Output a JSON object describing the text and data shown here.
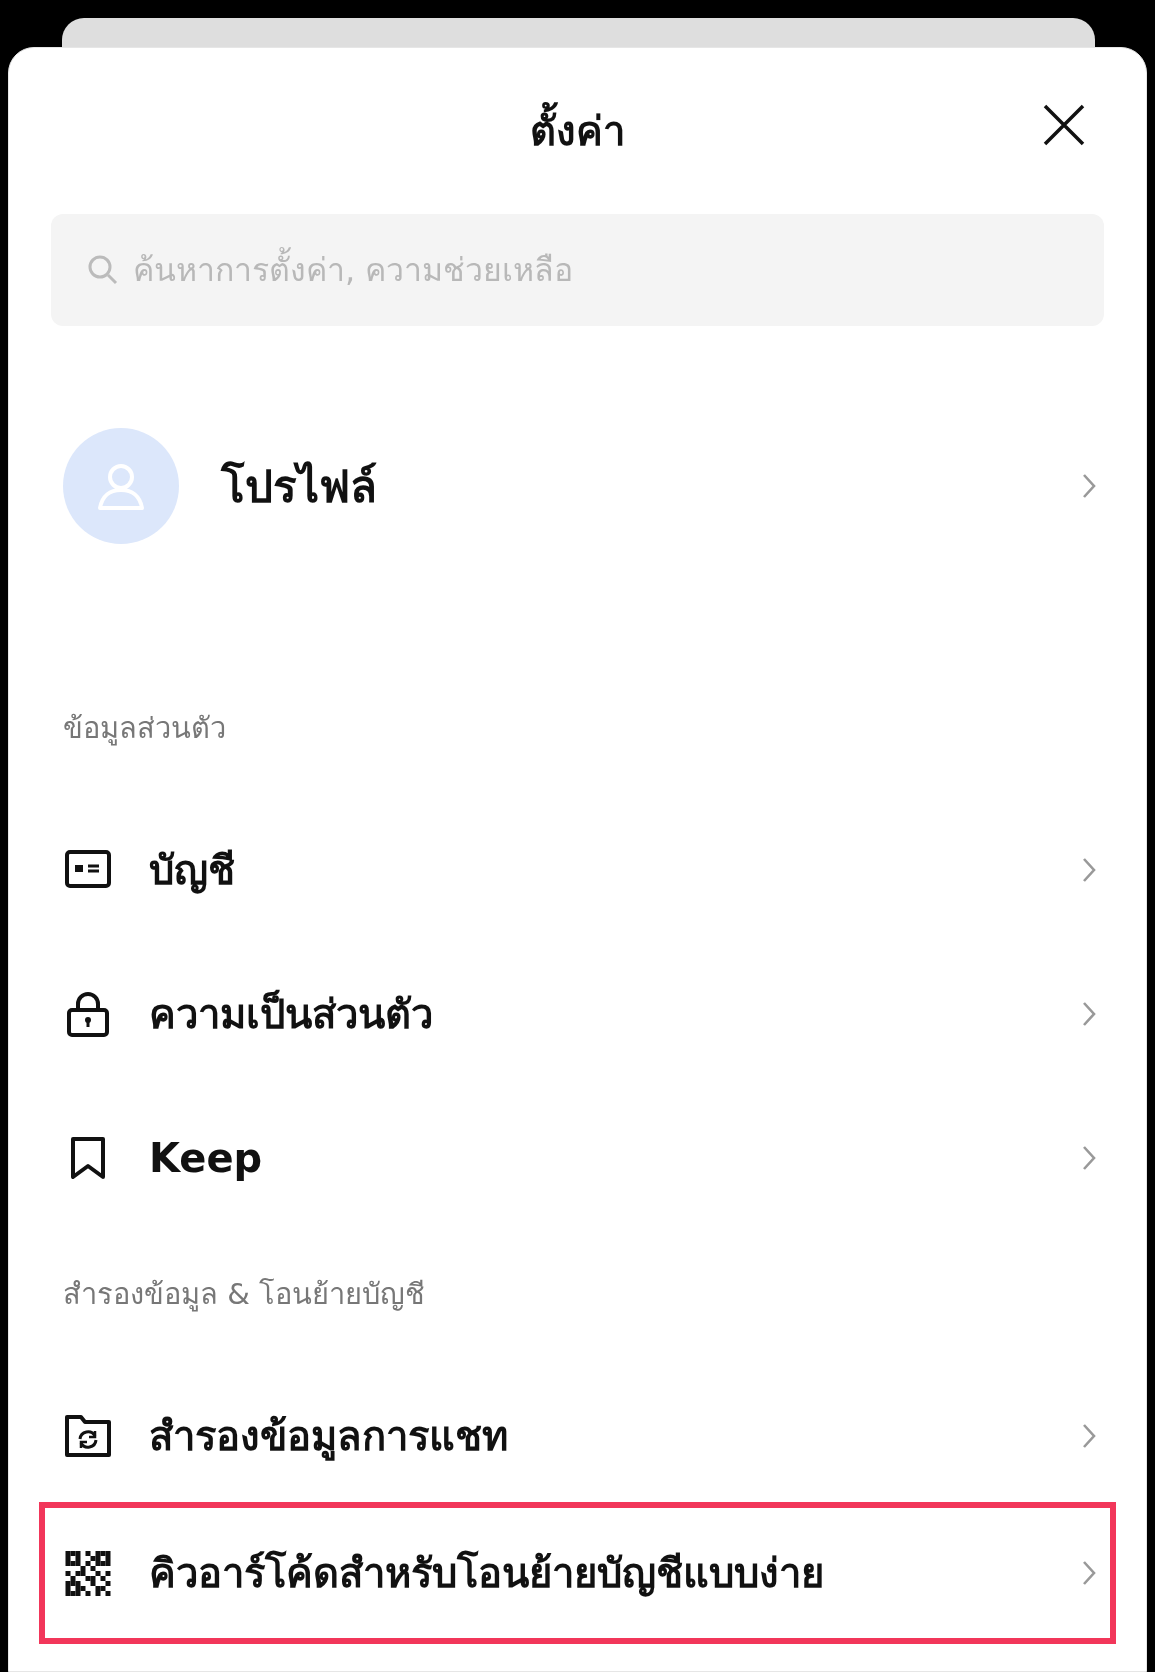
{
  "title": "ตั้งค่า",
  "search": {
    "placeholder": "ค้นหาการตั้งค่า, ความช่วยเหลือ"
  },
  "profile": {
    "label": "โปรไฟล์"
  },
  "sections": [
    {
      "heading": "ข้อมูลส่วนตัว",
      "items": [
        {
          "kind": "id-card",
          "label": "บัญชี",
          "highlighted": false
        },
        {
          "kind": "lock",
          "label": "ความเป็นส่วนตัว",
          "highlighted": false
        },
        {
          "kind": "bookmark",
          "label": "Keep",
          "highlighted": false
        }
      ]
    },
    {
      "heading": "สำรองข้อมูล & โอนย้ายบัญชี",
      "items": [
        {
          "kind": "folder-sync",
          "label": "สำรองข้อมูลการแชท",
          "highlighted": false
        },
        {
          "kind": "qr",
          "label": "คิวอาร์โค้ดสำหรับโอนย้ายบัญชีแบบง่าย",
          "highlighted": true
        }
      ]
    }
  ]
}
